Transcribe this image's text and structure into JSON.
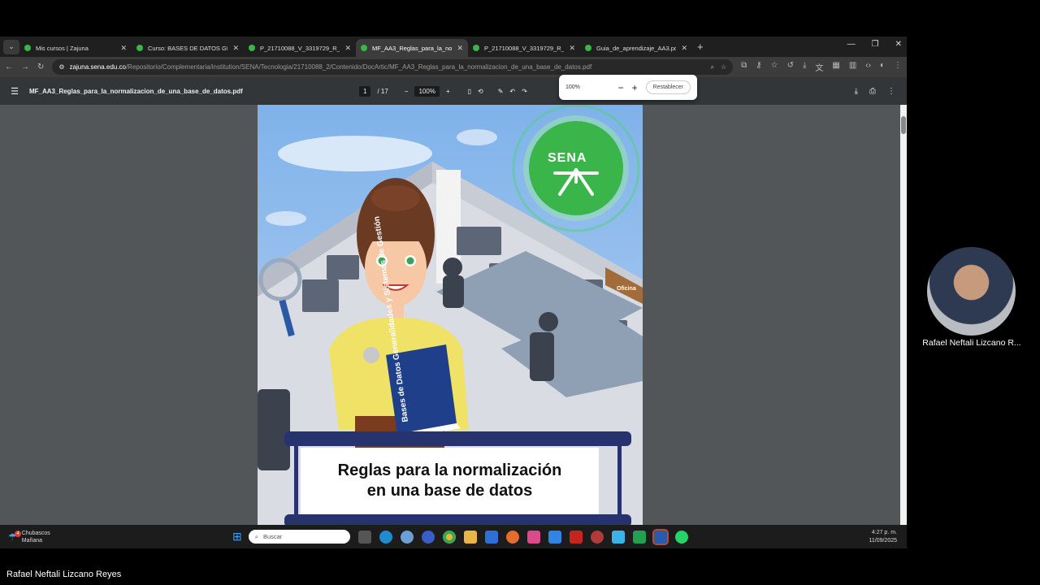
{
  "browser": {
    "tabs": [
      {
        "title": "Mis cursos | Zajuna",
        "active": false
      },
      {
        "title": "Curso: BASES DE DATOS GENER",
        "active": false
      },
      {
        "title": "P_21710088_V_3319729_R_68_C",
        "active": false
      },
      {
        "title": "MF_AA3_Reglas_para_la_norma",
        "active": true
      },
      {
        "title": "P_21710088_V_3319729_R_68_C",
        "active": false
      },
      {
        "title": "Guia_de_aprendizaje_AA3.pdf",
        "active": false
      }
    ],
    "url_host": "zajuna.sena.edu.co",
    "url_path": "/Repositorio/Complementaria/institution/SENA/Tecnologia/21710088_2/Contenido/DocArtic/MF_AA3_Reglas_para_la_normalizacion_de_una_base_de_datos.pdf"
  },
  "pdf": {
    "filename": "MF_AA3_Reglas_para_la_normalizacion_de_una_base_de_datos.pdf",
    "page_current": "1",
    "page_total": "/ 17",
    "zoom": "100%"
  },
  "zoom_popup": {
    "value": "100%",
    "reset_label": "Restablecer"
  },
  "cover": {
    "logo_text": "SENA",
    "title": "Reglas para la normalización en una base de datos",
    "book_text": "Bases de Datos Generalidades y Sistemas de Gestión",
    "sign_text": "Oficina"
  },
  "taskbar": {
    "weather_title": "Chubascos",
    "weather_sub": "Mañana",
    "weather_badge": "4",
    "search_placeholder": "Buscar",
    "time": "4:27 p. m.",
    "date": "11/09/2025"
  },
  "meeting": {
    "participant_name": "Rafael Neftali Lizcano R...",
    "speaker_name": "Rafael Neftali Lizcano Reyes"
  }
}
